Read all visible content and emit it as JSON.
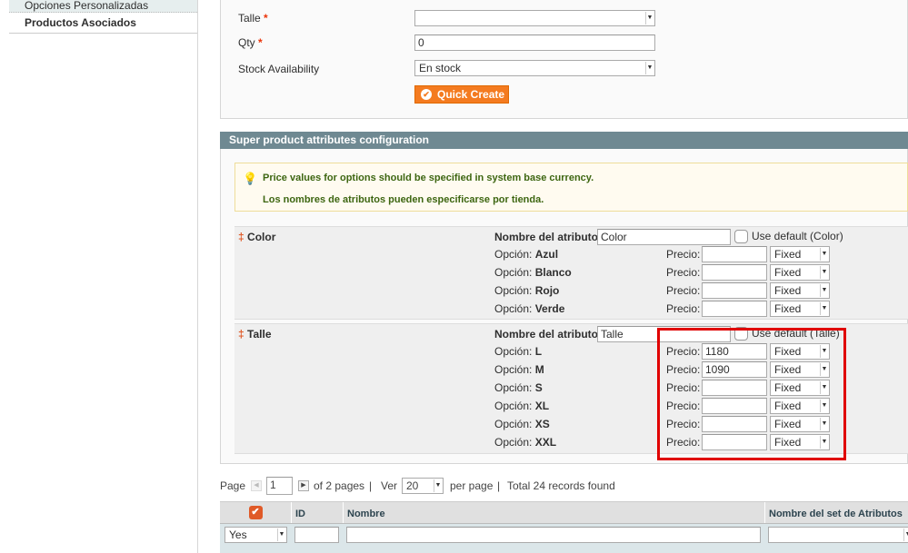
{
  "sidebar": {
    "tabs": [
      {
        "label": "Opciones Personalizadas"
      },
      {
        "label": "Productos Asociados"
      }
    ]
  },
  "quick_create": {
    "talle_label": "Talle",
    "talle_value": "",
    "qty_label": "Qty",
    "qty_value": "0",
    "stock_label": "Stock Availability",
    "stock_value": "En stock",
    "required_mark": "*",
    "button_label": "Quick Create"
  },
  "super_attrs": {
    "title": "Super product attributes configuration",
    "notices": [
      "Price values for options should be specified in system base currency.",
      "Los nombres de atributos pueden especificarse por tienda."
    ],
    "name_label": "Nombre del atributo:",
    "option_prefix": "Opción:",
    "price_label": "Precio:",
    "attributes": [
      {
        "label": "Color",
        "name_value": "Color",
        "use_default": "Use default (Color)",
        "options": [
          {
            "name": "Azul",
            "price": "",
            "type": "Fixed"
          },
          {
            "name": "Blanco",
            "price": "",
            "type": "Fixed"
          },
          {
            "name": "Rojo",
            "price": "",
            "type": "Fixed"
          },
          {
            "name": "Verde",
            "price": "",
            "type": "Fixed"
          }
        ]
      },
      {
        "label": "Talle",
        "name_value": "Talle",
        "use_default": "Use default (Talle)",
        "options": [
          {
            "name": "L",
            "price": "1180",
            "type": "Fixed"
          },
          {
            "name": "M",
            "price": "1090",
            "type": "Fixed"
          },
          {
            "name": "S",
            "price": "",
            "type": "Fixed"
          },
          {
            "name": "XL",
            "price": "",
            "type": "Fixed"
          },
          {
            "name": "XS",
            "price": "",
            "type": "Fixed"
          },
          {
            "name": "XXL",
            "price": "",
            "type": "Fixed"
          }
        ]
      }
    ],
    "highlight_color": "#e00000"
  },
  "pager": {
    "page_label": "Page",
    "page_value": "1",
    "of_pages": "of 2 pages",
    "sep": "|",
    "view_label": "Ver",
    "per_page": "20",
    "per_page_label": "per page",
    "total": "Total 24 records found"
  },
  "grid": {
    "columns": [
      "",
      "ID",
      "Nombre",
      "Nombre del set de Atributos"
    ],
    "filter_in_products": "Yes"
  }
}
